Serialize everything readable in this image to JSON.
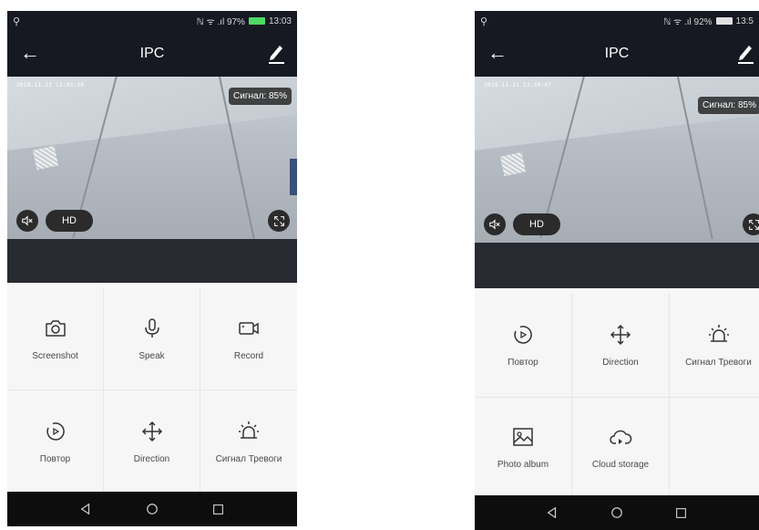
{
  "colors": {
    "bar_bg": "#161922",
    "strip_bg": "#272a31",
    "grid_bg": "#f6f6f6",
    "nav_bg": "#0d0d0d",
    "battery_green": "#4cd964"
  },
  "left": {
    "status": {
      "search_icon": "search-icon",
      "indicators": "ℕ ᯤ .ıl 97%",
      "time": "13:03"
    },
    "header": {
      "back_icon": "arrow-left-icon",
      "title": "IPC",
      "edit_icon": "pencil-icon"
    },
    "video": {
      "timestamp": "2019-11-21 13:03:39",
      "signal": "Сигнал: 85%",
      "mute_icon": "speaker-mute-icon",
      "quality": "HD",
      "fullscreen_icon": "expand-icon"
    },
    "actions": [
      {
        "label": "Screenshot",
        "icon": "camera-icon"
      },
      {
        "label": "Speak",
        "icon": "microphone-icon"
      },
      {
        "label": "Record",
        "icon": "video-camera-icon"
      },
      {
        "label": "Повтор",
        "icon": "replay-icon"
      },
      {
        "label": "Direction",
        "icon": "direction-arrows-icon"
      },
      {
        "label": "Сигнал Тревоги",
        "icon": "alarm-icon"
      }
    ],
    "nav": [
      "back-triangle-icon",
      "home-circle-icon",
      "recents-square-icon"
    ]
  },
  "right": {
    "status": {
      "search_icon": "search-icon",
      "indicators": "ℕ ᯤ .ıl 92%",
      "time": "13:5"
    },
    "header": {
      "back_icon": "arrow-left-icon",
      "title": "IPC",
      "edit_icon": "pencil-icon"
    },
    "video": {
      "timestamp": "2019-11-21 13:50:07",
      "signal": "Сигнал: 85%",
      "mute_icon": "speaker-mute-icon",
      "quality": "HD",
      "fullscreen_icon": "expand-icon"
    },
    "actions": [
      {
        "label": "Повтор",
        "icon": "replay-icon"
      },
      {
        "label": "Direction",
        "icon": "direction-arrows-icon"
      },
      {
        "label": "Сигнал Тревоги",
        "icon": "alarm-icon"
      },
      {
        "label": "Photo album",
        "icon": "photo-icon"
      },
      {
        "label": "Cloud storage",
        "icon": "cloud-icon"
      }
    ],
    "nav": [
      "back-triangle-icon",
      "home-circle-icon",
      "recents-square-icon"
    ]
  }
}
